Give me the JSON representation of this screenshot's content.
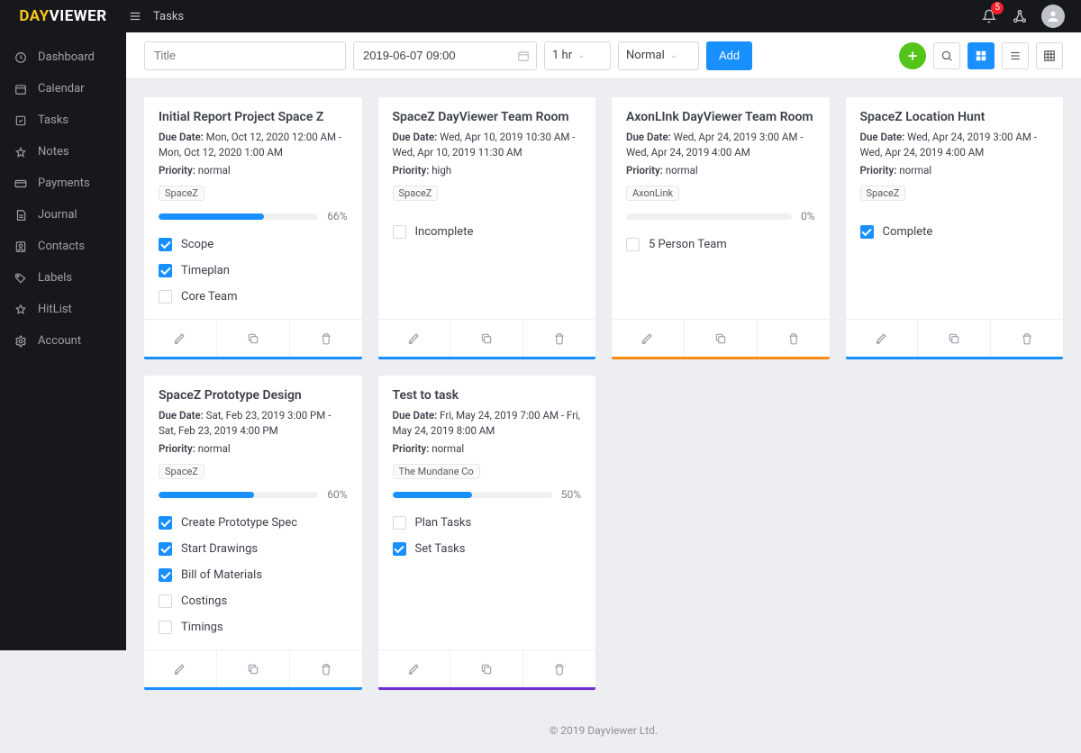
{
  "app": {
    "logo_a": "DAY",
    "logo_b": "VIEWER"
  },
  "header": {
    "page_title": "Tasks",
    "notif_count": "5"
  },
  "sidebar": {
    "items": [
      {
        "label": "Dashboard"
      },
      {
        "label": "Calendar"
      },
      {
        "label": "Tasks"
      },
      {
        "label": "Notes"
      },
      {
        "label": "Payments"
      },
      {
        "label": "Journal"
      },
      {
        "label": "Contacts"
      },
      {
        "label": "Labels"
      },
      {
        "label": "HitList"
      },
      {
        "label": "Account"
      }
    ]
  },
  "toolbar": {
    "title_placeholder": "Title",
    "date_value": "2019-06-07 09:00",
    "duration": "1 hr",
    "priority": "Normal",
    "add_label": "Add"
  },
  "cards": [
    {
      "title": "Initial Report Project Space Z",
      "due": "Due Date: Mon, Oct 12, 2020 12:00 AM - Mon, Oct 12, 2020 1:00 AM",
      "priority": "Priority: normal",
      "tag": "SpaceZ",
      "progress": 66,
      "progress_label": "66%",
      "subs": [
        {
          "label": "Scope",
          "done": true
        },
        {
          "label": "Timeplan",
          "done": true
        },
        {
          "label": "Core Team",
          "done": false
        }
      ],
      "accent": "#1890ff"
    },
    {
      "title": "SpaceZ DayViewer Team Room",
      "due": "Due Date: Wed, Apr 10, 2019 10:30 AM - Wed, Apr 10, 2019 11:30 AM",
      "priority": "Priority: high",
      "tag": "SpaceZ",
      "progress": null,
      "progress_label": "",
      "subs": [
        {
          "label": "Incomplete",
          "done": false
        }
      ],
      "accent": "#1890ff"
    },
    {
      "title": "AxonLInk DayViewer Team Room",
      "due": "Due Date: Wed, Apr 24, 2019 3:00 AM - Wed, Apr 24, 2019 4:00 AM",
      "priority": "Priority: normal",
      "tag": "AxonLink",
      "progress": 0,
      "progress_label": "0%",
      "subs": [
        {
          "label": "5 Person Team",
          "done": false
        }
      ],
      "accent": "#fa8c16"
    },
    {
      "title": "SpaceZ Location Hunt",
      "due": "Due Date: Wed, Apr 24, 2019 3:00 AM - Wed, Apr 24, 2019 4:00 AM",
      "priority": "Priority: normal",
      "tag": "SpaceZ",
      "progress": null,
      "progress_label": "",
      "subs": [
        {
          "label": "Complete",
          "done": true
        }
      ],
      "accent": "#1890ff"
    },
    {
      "title": "SpaceZ Prototype Design",
      "due": "Due Date: Sat, Feb 23, 2019 3:00 PM - Sat, Feb 23, 2019 4:00 PM",
      "priority": "Priority: normal",
      "tag": "SpaceZ",
      "progress": 60,
      "progress_label": "60%",
      "subs": [
        {
          "label": "Create Prototype Spec",
          "done": true
        },
        {
          "label": "Start Drawings",
          "done": true
        },
        {
          "label": "Bill of Materials",
          "done": true
        },
        {
          "label": "Costings",
          "done": false
        },
        {
          "label": "Timings",
          "done": false
        }
      ],
      "accent": "#1890ff"
    },
    {
      "title": "Test to task",
      "due": "Due Date: Fri, May 24, 2019 7:00 AM - Fri, May 24, 2019 8:00 AM",
      "priority": "Priority: normal",
      "tag": "The Mundane Co",
      "progress": 50,
      "progress_label": "50%",
      "subs": [
        {
          "label": "Plan Tasks",
          "done": false
        },
        {
          "label": "Set Tasks",
          "done": true
        }
      ],
      "accent": "#722ed1"
    }
  ],
  "footer": "© 2019 Dayviewer Ltd."
}
